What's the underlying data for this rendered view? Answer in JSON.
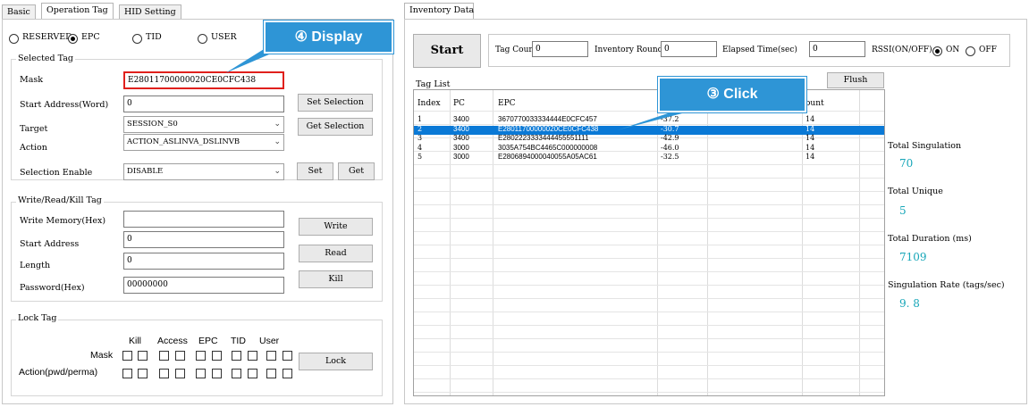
{
  "tabs": {
    "basic": "Basic",
    "operation": "Operation Tag",
    "hid": "HID Setting",
    "inventory": "Inventory Data"
  },
  "bank": {
    "reserved": "RESERVED",
    "epc": "EPC",
    "tid": "TID",
    "user": "USER",
    "selected": "epc"
  },
  "selected_tag": {
    "title": "Selected Tag",
    "mask_label": "Mask",
    "mask_value": "E28011700000020CE0CFC438",
    "start_label": "Start Address(Word)",
    "start_value": "0",
    "target_label": "Target",
    "target_value": "SESSION_S0",
    "action_label": "Action",
    "action_value": "ACTION_ASLINVA_DSLINVB",
    "enable_label": "Selection Enable",
    "enable_value": "DISABLE",
    "set_selection": "Set Selection",
    "get_selection": "Get Selection",
    "set": "Set",
    "get": "Get"
  },
  "wrk": {
    "title": "Write/Read/Kill Tag",
    "write_mem_label": "Write Memory(Hex)",
    "write_mem_value": "",
    "start_label": "Start Address",
    "start_value": "0",
    "length_label": "Length",
    "length_value": "0",
    "password_label": "Password(Hex)",
    "password_value": "00000000",
    "write": "Write",
    "read": "Read",
    "kill": "Kill"
  },
  "lock": {
    "title": "Lock Tag",
    "headers": [
      "Kill",
      "Access",
      "EPC",
      "TID",
      "User"
    ],
    "mask_label": "Mask",
    "action_label": "Action(pwd/perma)",
    "lock_button": "Lock"
  },
  "inventory": {
    "start": "Start",
    "tag_count_label": "Tag Count",
    "tag_count_value": "0",
    "round_label": "Inventory Round",
    "round_value": "0",
    "elapsed_label": "Elapsed Time(sec)",
    "elapsed_value": "0",
    "rssi_label": "RSSI(ON/OFF)",
    "rssi_on": "ON",
    "rssi_off": "OFF",
    "rssi_selected": "on",
    "tag_list_label": "Tag List",
    "flush": "Flush"
  },
  "tag_table": {
    "headers": {
      "index": "Index",
      "pc": "PC",
      "epc": "EPC",
      "rssi": "",
      "count": "ount"
    },
    "rows": [
      {
        "index": "1",
        "pc": "3400",
        "epc": "3670770033334444E0CFC457",
        "rssi": "-37.2",
        "count": "14"
      },
      {
        "index": "2",
        "pc": "3400",
        "epc": "E28011700000020CE0CFC438",
        "rssi": "-30.7",
        "count": "14",
        "selected": true
      },
      {
        "index": "3",
        "pc": "3400",
        "epc": "E2802223333444455551111",
        "rssi": "-42.9",
        "count": "14"
      },
      {
        "index": "4",
        "pc": "3000",
        "epc": "3035A754BC4465C000000008",
        "rssi": "-46.0",
        "count": "14"
      },
      {
        "index": "5",
        "pc": "3000",
        "epc": "E2806894000040055A05AC61",
        "rssi": "-32.5",
        "count": "14"
      }
    ]
  },
  "stats": {
    "singulation_label": "Total Singulation",
    "singulation_value": "70",
    "unique_label": "Total Unique",
    "unique_value": "5",
    "duration_label": "Total Duration (ms)",
    "duration_value": "7109",
    "rate_label": "Singulation Rate (tags/sec)",
    "rate_value": "9. 8"
  },
  "callouts": {
    "display": "④  Display",
    "click": "③  Click"
  },
  "colors": {
    "selection": "#0a79d6",
    "callout": "#2e95d6",
    "stat_value": "#16a6b8",
    "mask_highlight": "#e0201c"
  }
}
